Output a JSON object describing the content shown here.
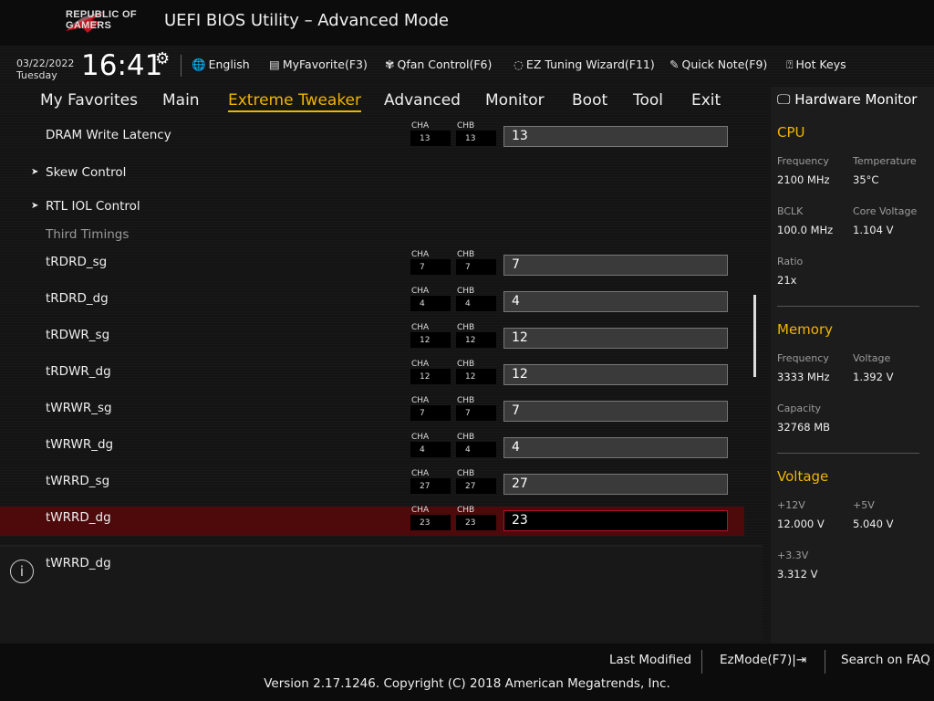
{
  "header": {
    "logo_text_1": "REPUBLIC OF",
    "logo_text_2": "GAMERS",
    "title": "UEFI BIOS Utility – Advanced Mode"
  },
  "toolbar": {
    "date": "03/22/2022",
    "day": "Tuesday",
    "time": "16:41",
    "language": "English",
    "my_favorite": "MyFavorite(F3)",
    "qfan": "Qfan Control(F6)",
    "ez_tuning": "EZ Tuning Wizard(F11)",
    "quick_note": "Quick Note(F9)",
    "hot_keys": "Hot Keys"
  },
  "tabs": [
    "My Favorites",
    "Main",
    "Extreme Tweaker",
    "Advanced",
    "Monitor",
    "Boot",
    "Tool",
    "Exit"
  ],
  "active_tab": "Extreme Tweaker",
  "content": {
    "dram_write_latency": {
      "label": "DRAM Write Latency",
      "cha": "13",
      "chb": "13",
      "value": "13"
    },
    "skew_control": "Skew Control",
    "rtl_iol": "RTL IOL Control",
    "third_timings": "Third Timings",
    "cha_label": "CHA",
    "chb_label": "CHB",
    "rows": [
      {
        "label": "tRDRD_sg",
        "cha": "7",
        "chb": "7",
        "value": "7"
      },
      {
        "label": "tRDRD_dg",
        "cha": "4",
        "chb": "4",
        "value": "4"
      },
      {
        "label": "tRDWR_sg",
        "cha": "12",
        "chb": "12",
        "value": "12"
      },
      {
        "label": "tRDWR_dg",
        "cha": "12",
        "chb": "12",
        "value": "12"
      },
      {
        "label": "tWRWR_sg",
        "cha": "7",
        "chb": "7",
        "value": "7"
      },
      {
        "label": "tWRWR_dg",
        "cha": "4",
        "chb": "4",
        "value": "4"
      },
      {
        "label": "tWRRD_sg",
        "cha": "27",
        "chb": "27",
        "value": "27"
      },
      {
        "label": "tWRRD_dg",
        "cha": "23",
        "chb": "23",
        "value": "23"
      }
    ]
  },
  "info": {
    "text": "tWRRD_dg"
  },
  "hardware_monitor": {
    "title": "Hardware Monitor",
    "cpu": {
      "heading": "CPU",
      "frequency_label": "Frequency",
      "frequency": "2100 MHz",
      "temperature_label": "Temperature",
      "temperature": "35°C",
      "bclk_label": "BCLK",
      "bclk": "100.0 MHz",
      "core_voltage_label": "Core Voltage",
      "core_voltage": "1.104 V",
      "ratio_label": "Ratio",
      "ratio": "21x"
    },
    "memory": {
      "heading": "Memory",
      "frequency_label": "Frequency",
      "frequency": "3333 MHz",
      "voltage_label": "Voltage",
      "voltage": "1.392 V",
      "capacity_label": "Capacity",
      "capacity": "32768 MB"
    },
    "voltage": {
      "heading": "Voltage",
      "v12_label": "+12V",
      "v12": "12.000 V",
      "v5_label": "+5V",
      "v5": "5.040 V",
      "v33_label": "+3.3V",
      "v33": "3.312 V"
    }
  },
  "footer": {
    "last_modified": "Last Modified",
    "ezmode": "EzMode(F7)|⇥",
    "search_faq": "Search on FAQ",
    "copyright": "Version 2.17.1246. Copyright (C) 2018 American Megatrends, Inc."
  },
  "colors": {
    "accent": "#f0b400",
    "highlight": "#4e0a0b"
  }
}
